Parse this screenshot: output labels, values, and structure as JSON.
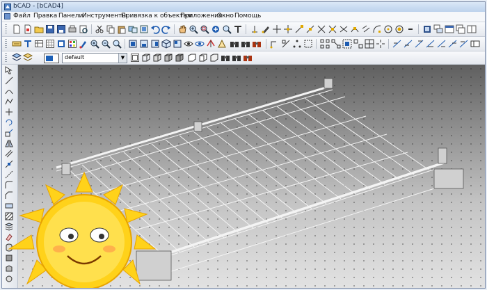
{
  "window": {
    "title": "bCAD - [bCAD4]"
  },
  "menu": {
    "items": [
      "Файл",
      "Правка",
      "Панели",
      "Инструменты",
      "Привязка к объектам",
      "Приложения",
      "Окно",
      "Помощь"
    ]
  },
  "layer": {
    "name": "default"
  },
  "colors": {
    "layer_swatch": "#1b5fb6",
    "canvas_top": "#5f5f5f",
    "canvas_bottom": "#e2e2e2",
    "sun": "#ffd21a"
  }
}
